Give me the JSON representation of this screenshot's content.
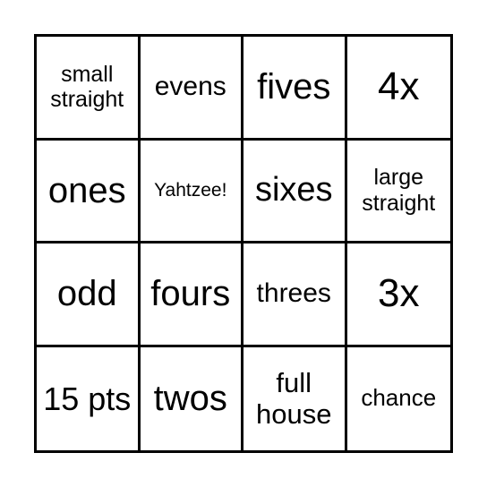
{
  "cells": [
    {
      "text": "small straight",
      "size": 25
    },
    {
      "text": "evens",
      "size": 30
    },
    {
      "text": "fives",
      "size": 40
    },
    {
      "text": "4x",
      "size": 44
    },
    {
      "text": "ones",
      "size": 40
    },
    {
      "text": "Yahtzee!",
      "size": 21
    },
    {
      "text": "sixes",
      "size": 38
    },
    {
      "text": "large straight",
      "size": 25
    },
    {
      "text": "odd",
      "size": 40
    },
    {
      "text": "fours",
      "size": 40
    },
    {
      "text": "threes",
      "size": 30
    },
    {
      "text": "3x",
      "size": 44
    },
    {
      "text": "15 pts",
      "size": 36
    },
    {
      "text": "twos",
      "size": 40
    },
    {
      "text": "full house",
      "size": 31
    },
    {
      "text": "chance",
      "size": 26
    }
  ]
}
